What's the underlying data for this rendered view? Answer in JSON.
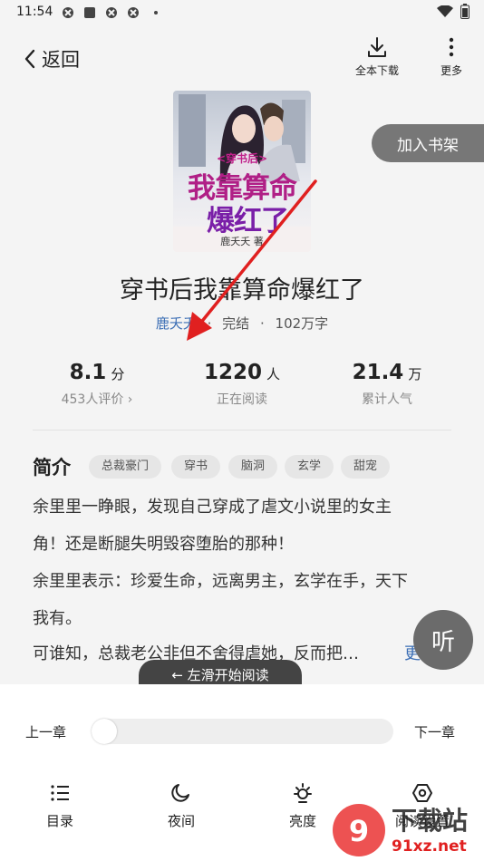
{
  "status": {
    "time": "11:54"
  },
  "header": {
    "back_label": "返回",
    "download_label": "全本下载",
    "more_label": "更多"
  },
  "book": {
    "cover_title_small": "<穿书后>",
    "cover_title_line1": "我靠算命",
    "cover_title_line2": "爆红了",
    "cover_author": "鹿夭夭",
    "cover_author_suffix": "著",
    "shelf_button": "加入书架",
    "title": "穿书后我靠算命爆红了",
    "author": "鹿夭夭",
    "sep": "·",
    "status": "完结",
    "words": "102万字"
  },
  "stats": [
    {
      "num": "8.1",
      "unit": "分",
      "label": "453人评价 ›"
    },
    {
      "num": "1220",
      "unit": "人",
      "label": "正在阅读"
    },
    {
      "num": "21.4",
      "unit": "万",
      "label": "累计人气"
    }
  ],
  "intro": {
    "heading": "简介",
    "tags": [
      "总裁豪门",
      "穿书",
      "脑洞",
      "玄学",
      "甜宠"
    ],
    "lines": [
      "余里里一睁眼，发现自己穿成了虐文小说里的女主",
      "角！还是断腿失明毁容堕胎的那种！",
      "余里里表示：珍爱生命，远离男主，玄学在手，天下",
      "我有。",
      "可谁知，总裁老公非但不舍得虐她，反而把…"
    ],
    "more": "更"
  },
  "listen_label": "听",
  "hint": "← 左滑开始阅读",
  "reader": {
    "prev": "上一章",
    "next": "下一章",
    "progress": 0,
    "tools": [
      {
        "label": "目录",
        "icon": "list-icon"
      },
      {
        "label": "夜间",
        "icon": "moon-icon"
      },
      {
        "label": "亮度",
        "icon": "brightness-icon"
      },
      {
        "label": "阅读设置",
        "icon": "settings-icon"
      }
    ]
  },
  "watermark": {
    "line1": "下载站",
    "line2": "91xz.net"
  },
  "colors": {
    "author": "#3d6fb5",
    "arrow": "#e02020",
    "button_grey": "#777777"
  }
}
